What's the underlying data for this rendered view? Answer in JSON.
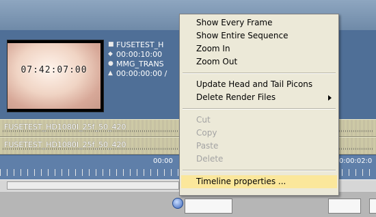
{
  "clip": {
    "thumbnail_timecode": "07:42:07:00",
    "info": {
      "name": "FUSETEST_H",
      "duration": "00:00:10:00",
      "media": "MMG_TRANS",
      "timecode_range": "00:00:00:00 /"
    }
  },
  "tracks": [
    {
      "label": "FUSETEST_HD1080I_25f_50_420"
    },
    {
      "label": "FUSETEST_HD1080I_25f_50_420"
    }
  ],
  "ruler": {
    "label_center": "00:00",
    "label_right": "0:00:02:0"
  },
  "context_menu": {
    "items": [
      {
        "label": "Show Every Frame",
        "enabled": true
      },
      {
        "label": "Show Entire Sequence",
        "enabled": true
      },
      {
        "label": "Zoom In",
        "enabled": true
      },
      {
        "label": "Zoom Out",
        "enabled": true
      },
      {
        "label": "Update Head and Tail Picons",
        "enabled": true
      },
      {
        "label": "Delete Render Files",
        "enabled": true,
        "submenu": true
      },
      {
        "label": "Cut",
        "enabled": false
      },
      {
        "label": "Copy",
        "enabled": false
      },
      {
        "label": "Paste",
        "enabled": false
      },
      {
        "label": "Delete",
        "enabled": false
      },
      {
        "label": "Timeline properties ...",
        "enabled": true,
        "highlighted": true
      }
    ]
  },
  "colors": {
    "timeline_bg": "#4f6f97",
    "track": "#cdc9a6",
    "menu_bg": "#ece9d8",
    "menu_highlight": "#fbe79b"
  }
}
